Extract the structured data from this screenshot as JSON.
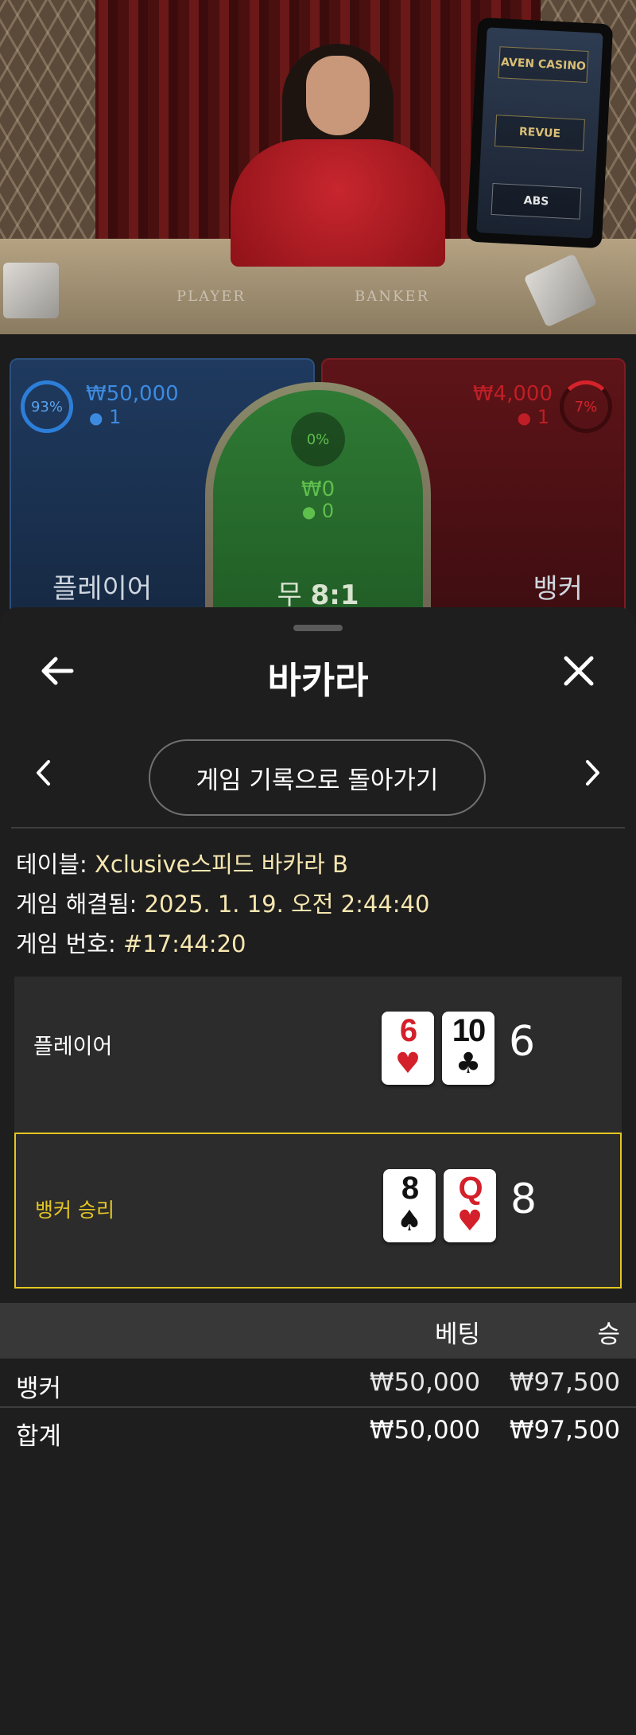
{
  "video": {
    "table_words": {
      "player": "PLAYER",
      "banker": "BANKER"
    },
    "sponsors": [
      {
        "name": "AVEN CASINO"
      },
      {
        "name": "REVUE"
      },
      {
        "name": "ABS"
      }
    ]
  },
  "betting": {
    "player": {
      "percent": "93%",
      "amount": "₩50,000",
      "players": "1",
      "label": "플레이어",
      "color": "#2d7ed8",
      "percent_value": 93
    },
    "tie": {
      "percent": "0%",
      "amount": "₩0",
      "players": "0",
      "label": "무",
      "odds": "8:1",
      "color": "#39b54a",
      "percent_value": 0
    },
    "banker": {
      "percent": "7%",
      "amount": "₩4,000",
      "players": "1",
      "label": "뱅커",
      "color": "#d6232b",
      "percent_value": 7
    }
  },
  "sheet": {
    "title": "바카라",
    "back_to_history": "게임 기록으로 돌아가기",
    "info": {
      "table_label": "테이블:",
      "table_value": "Xclusive스피드 바카라 B",
      "resolved_label": "게임 해결됨:",
      "resolved_value": "2025. 1. 19. 오전 2:44:40",
      "number_label": "게임 번호:",
      "number_value": "#17:44:20"
    },
    "hands": {
      "player": {
        "label": "플레이어",
        "cards": [
          {
            "rank": "6",
            "suit": "♥",
            "color": "red"
          },
          {
            "rank": "10",
            "suit": "♣",
            "color": "black"
          }
        ],
        "total": "6"
      },
      "banker": {
        "label": "뱅커 승리",
        "cards": [
          {
            "rank": "8",
            "suit": "♠",
            "color": "black"
          },
          {
            "rank": "Q",
            "suit": "♥",
            "color": "red"
          }
        ],
        "total": "8",
        "highlight_color": "#e3c622"
      }
    },
    "bets_table": {
      "headers": {
        "bet": "베팅",
        "win": "승"
      },
      "rows": [
        {
          "name": "뱅커",
          "bet": "₩50,000",
          "win": "₩97,500"
        }
      ],
      "total": {
        "name": "합계",
        "bet": "₩50,000",
        "win": "₩97,500"
      }
    }
  }
}
